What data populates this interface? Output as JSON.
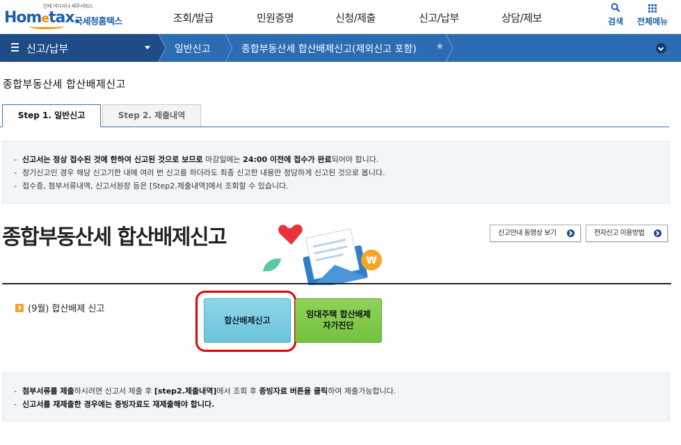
{
  "header": {
    "logo_tagline": "언제 어디서나 세무서비스",
    "logo_brand_a": "Hom",
    "logo_brand_e": "e",
    "logo_brand_b": "tax.",
    "logo_kname": "국세청홈택스",
    "nav": [
      "조회/발급",
      "민원증명",
      "신청/제출",
      "신고/납부",
      "상담/제보"
    ],
    "search_label": "검색",
    "allmenu_label": "전체메뉴"
  },
  "location": {
    "menu_label": "신고/납부",
    "crumb1": "일반신고",
    "crumb2": "종합부동산세 합산배제신고(제외신고 포함)",
    "accent": "#2b6cb3"
  },
  "page_title": "종합부동산세 합산배제신고",
  "tabs": {
    "step1": "Step 1. 일반신고",
    "step2": "Step 2. 제출내역"
  },
  "info1": {
    "line1_b1": "신고서는 정상 접수된 것에 한하여 신고된 것으로 보므로",
    "line1_t1": " 마감일에는 ",
    "line1_b2": "24:00 이전에 접수가 완료",
    "line1_t2": "되어야 합니다.",
    "line2": "정기신고인 경우 해당 신고기한 내에 여러 번 신고를 하더라도 최종 신고한 내용만 정당하게 신고된 것으로 봅니다.",
    "line3": "접수증, 첨부서류내역, 신고서원장 등은 [Step2.제출내역]에서 조회할 수 있습니다."
  },
  "section": {
    "heading": "종합부동산세 합산배제신고",
    "video_btn": "신고안내 동영상 보기",
    "guide_btn": "전자신고 이용방법",
    "label": "(9월) 합산배제 신고",
    "main_btn": "합산배제신고",
    "green_btn_line1": "임대주택 합산배제",
    "green_btn_line2": "자가진단"
  },
  "info2": {
    "line1_b1": "첨부서류를 제출",
    "line1_t1": "하시려면 신고서 제출 후 ",
    "line1_b2": "[step2.제출내역]",
    "line1_t2": "에서 조회 후 ",
    "line1_b3": "증빙자료 버튼을 클릭",
    "line1_t3": "하여 제출가능합니다.",
    "line2": "신고서를 재제출한 경우에는 증빙자료도 재제출해야 합니다."
  }
}
